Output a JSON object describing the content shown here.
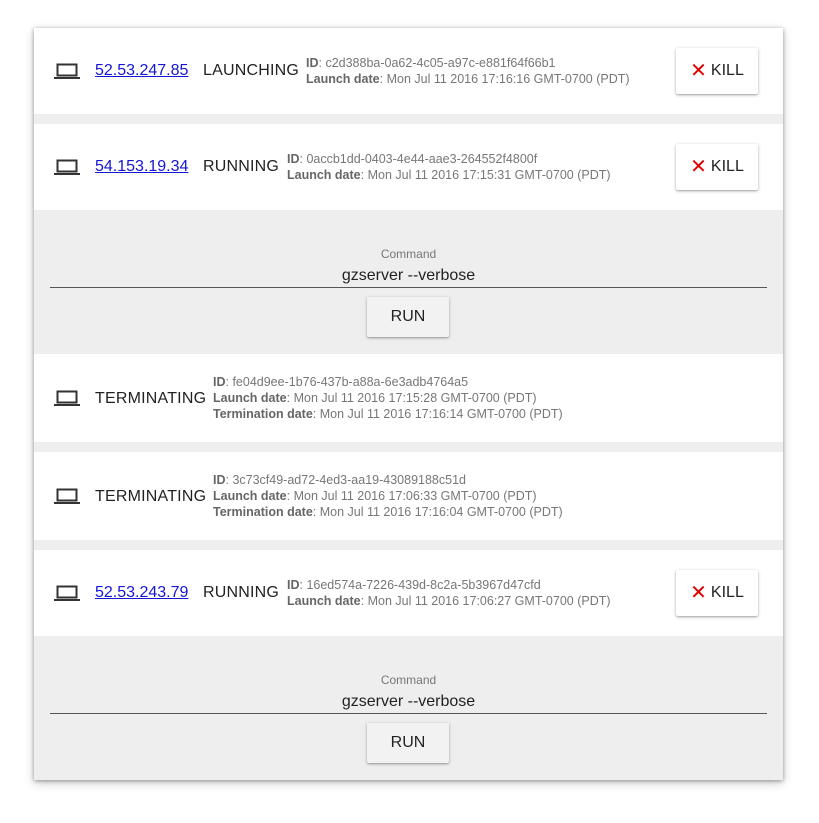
{
  "instances": [
    {
      "ip": "52.53.247.85",
      "status": "LAUNCHING",
      "id_label": "ID",
      "id": "c2d388ba-0a62-4c05-a97c-e881f64f66b1",
      "launch_label": "Launch date",
      "launch_date": "Mon Jul 11 2016 17:16:16 GMT-0700 (PDT)",
      "kill_label": "KILL"
    },
    {
      "ip": "54.153.19.34",
      "status": "RUNNING",
      "id_label": "ID",
      "id": "0accb1dd-0403-4e44-aae3-264552f4800f",
      "launch_label": "Launch date",
      "launch_date": "Mon Jul 11 2016 17:15:31 GMT-0700 (PDT)",
      "kill_label": "KILL",
      "command_label": "Command",
      "command_value": "gzserver --verbose",
      "run_label": "RUN"
    },
    {
      "status": "TERMINATING",
      "id_label": "ID",
      "id": "fe04d9ee-1b76-437b-a88a-6e3adb4764a5",
      "launch_label": "Launch date",
      "launch_date": "Mon Jul 11 2016 17:15:28 GMT-0700 (PDT)",
      "termination_label": "Termination date",
      "termination_date": "Mon Jul 11 2016 17:16:14 GMT-0700 (PDT)"
    },
    {
      "status": "TERMINATING",
      "id_label": "ID",
      "id": "3c73cf49-ad72-4ed3-aa19-43089188c51d",
      "launch_label": "Launch date",
      "launch_date": "Mon Jul 11 2016 17:06:33 GMT-0700 (PDT)",
      "termination_label": "Termination date",
      "termination_date": "Mon Jul 11 2016 17:16:04 GMT-0700 (PDT)"
    },
    {
      "ip": "52.53.243.79",
      "status": "RUNNING",
      "id_label": "ID",
      "id": "16ed574a-7226-439d-8c2a-5b3967d47cfd",
      "launch_label": "Launch date",
      "launch_date": "Mon Jul 11 2016 17:06:27 GMT-0700 (PDT)",
      "kill_label": "KILL",
      "command_label": "Command",
      "command_value": "gzserver --verbose",
      "run_label": "RUN"
    }
  ],
  "icons": {
    "instance": "laptop-icon",
    "kill": "close-icon"
  },
  "colors": {
    "link": "#1515d4",
    "kill_x": "#e00000"
  }
}
